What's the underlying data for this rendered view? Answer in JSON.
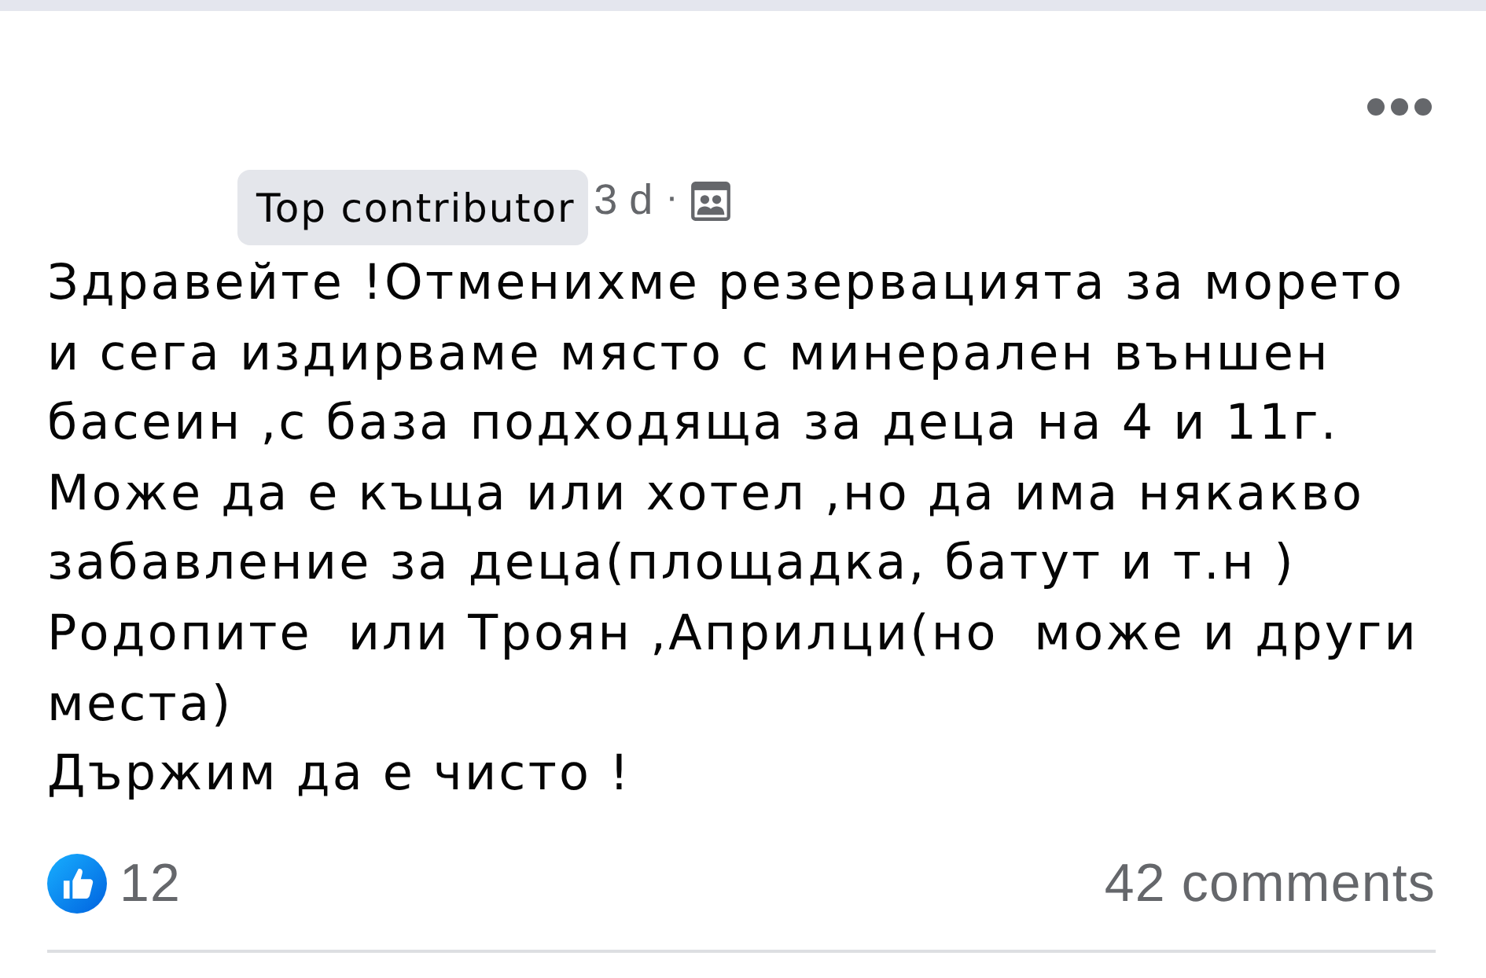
{
  "post": {
    "badge": "Top contributor",
    "time": "3 d",
    "separator": "·",
    "body": "Здравейте !Отменихме резервацията за морето\nи сега издирваме място с минерален външен\nбасеин ,с база подходяща за деца на 4 и 11г.\nМоже да е къща или хотел ,но да има някакво\nзабавление за деца(площадка, батут и т.н )\nРодопите  или Троян ,Априлци(но  може и други\nместа)\nДържим да е чисто !",
    "reactions_count": "12",
    "comments_count": "42 comments"
  }
}
